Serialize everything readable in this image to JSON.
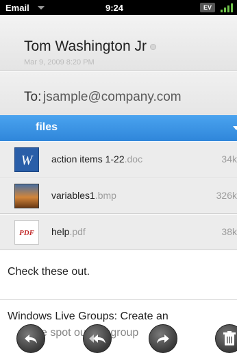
{
  "status_bar": {
    "app_name": "Email",
    "time": "9:24",
    "network_badge": "EV"
  },
  "message": {
    "sender": "Tom Washington Jr",
    "date": "Mar 9, 2009 8:20 PM",
    "to_label": "To:",
    "to_address": "jsample@company.com"
  },
  "attachments": {
    "header_label": "files",
    "items": [
      {
        "name": "action items 1-22",
        "ext": ".doc",
        "size": "34k",
        "icon": "word-document-icon"
      },
      {
        "name": "variables1",
        "ext": ".bmp",
        "size": "326k",
        "icon": "image-file-icon"
      },
      {
        "name": "help",
        "ext": ".pdf",
        "size": "38k",
        "icon": "pdf-file-icon"
      }
    ]
  },
  "body": {
    "line1": "Check these out.",
    "line2": "Windows Live Groups: Create an",
    "line3": "e spot  our fav  group"
  },
  "actions": {
    "reply_icon": "reply-icon",
    "reply_all_icon": "reply-all-icon",
    "forward_icon": "forward-icon",
    "delete_icon": "trash-icon"
  },
  "colors": {
    "files_bar": "#3b95e6",
    "status_bar": "#000000"
  }
}
